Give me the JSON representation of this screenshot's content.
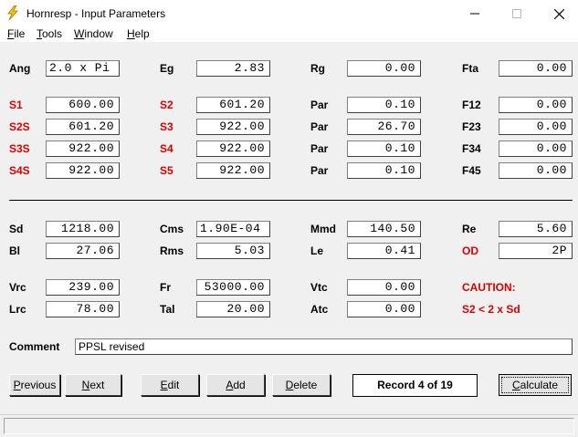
{
  "window": {
    "title": "Hornresp - Input Parameters"
  },
  "menu": [
    {
      "first": "F",
      "rest": "ile"
    },
    {
      "first": "T",
      "rest": "ools"
    },
    {
      "first": "W",
      "rest": "indow"
    },
    {
      "first": "H",
      "rest": "elp"
    }
  ],
  "colors": {
    "red_label": "#d40000"
  },
  "params": {
    "Ang": "2.0 x Pi",
    "Eg": "2.83",
    "Rg": "0.00",
    "Fta": "0.00",
    "S1": "600.00",
    "S2": "601.20",
    "Par1": "0.10",
    "F12": "0.00",
    "S2S": "601.20",
    "S3": "922.00",
    "Par2": "26.70",
    "F23": "0.00",
    "S3S": "922.00",
    "S4": "922.00",
    "Par3": "0.10",
    "F34": "0.00",
    "S4S": "922.00",
    "S5": "922.00",
    "Par4": "0.10",
    "F45": "0.00",
    "Sd": "1218.00",
    "Cms": "1.90E-04",
    "Mmd": "140.50",
    "Re": "5.60",
    "Bl": "27.06",
    "Rms": "5.03",
    "Le": "0.41",
    "OD": "2P",
    "Vrc": "239.00",
    "Fr": "53000.00",
    "Vtc": "0.00",
    "Lrc": "78.00",
    "Tal": "20.00",
    "Atc": "0.00"
  },
  "labels": {
    "Ang": "Ang",
    "Eg": "Eg",
    "Rg": "Rg",
    "Fta": "Fta",
    "S1": "S1",
    "S2": "S2",
    "Par": "Par",
    "F12": "F12",
    "S2S": "S2S",
    "S3": "S3",
    "F23": "F23",
    "S3S": "S3S",
    "S4": "S4",
    "F34": "F34",
    "S4S": "S4S",
    "S5": "S5",
    "F45": "F45",
    "Sd": "Sd",
    "Cms": "Cms",
    "Mmd": "Mmd",
    "Re": "Re",
    "Bl": "Bl",
    "Rms": "Rms",
    "Le": "Le",
    "OD": "OD",
    "Vrc": "Vrc",
    "Fr": "Fr",
    "Vtc": "Vtc",
    "Lrc": "Lrc",
    "Tal": "Tal",
    "Atc": "Atc",
    "Comment": "Comment"
  },
  "caution": {
    "title": "CAUTION:",
    "message": "S2 < 2 x Sd"
  },
  "comment": "PPSL revised",
  "buttons": {
    "previous": {
      "first": "P",
      "rest": "revious"
    },
    "next": {
      "first": "N",
      "rest": "ext"
    },
    "edit": {
      "first": "E",
      "rest": "dit"
    },
    "add": {
      "first": "A",
      "rest": "dd"
    },
    "delete": {
      "first": "D",
      "rest": "elete"
    },
    "calculate": {
      "first": "C",
      "rest": "alculate"
    }
  },
  "record": "Record 4 of 19"
}
